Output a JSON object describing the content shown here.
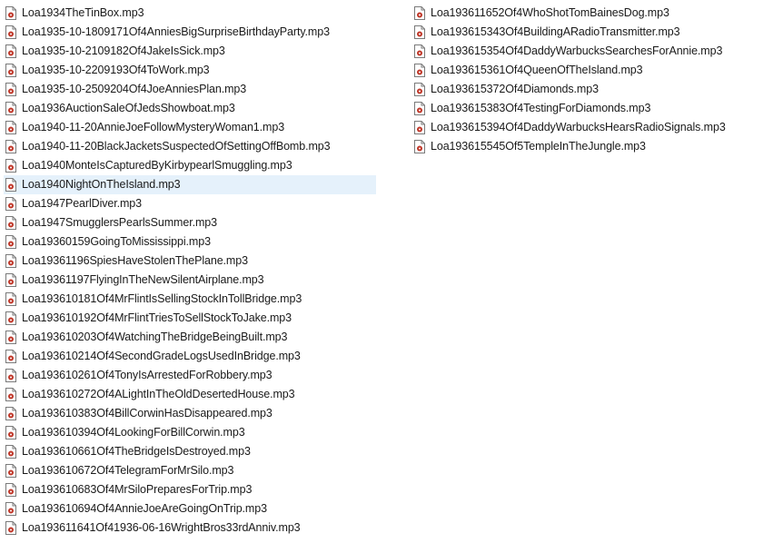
{
  "icon": "mp3-audio-file-icon",
  "colors": {
    "selection_background": "#e5f1fb",
    "icon_accent": "#c0392b"
  },
  "selected_file": "Loa1940NightOnTheIsland.mp3",
  "columns": [
    {
      "files": [
        "Loa1934TheTinBox.mp3",
        "Loa1935-10-1809171Of4AnniesBigSurpriseBirthdayParty.mp3",
        "Loa1935-10-2109182Of4JakeIsSick.mp3",
        "Loa1935-10-2209193Of4ToWork.mp3",
        "Loa1935-10-2509204Of4JoeAnniesPlan.mp3",
        "Loa1936AuctionSaleOfJedsShowboat.mp3",
        "Loa1940-11-20AnnieJoeFollowMysteryWoman1.mp3",
        "Loa1940-11-20BlackJacketsSuspectedOfSettingOffBomb.mp3",
        "Loa1940MonteIsCapturedByKirbypearlSmuggling.mp3",
        "Loa1940NightOnTheIsland.mp3",
        "Loa1947PearlDiver.mp3",
        "Loa1947SmugglersPearlsSummer.mp3",
        "Loa19360159GoingToMississippi.mp3",
        "Loa19361196SpiesHaveStolenThePlane.mp3",
        "Loa19361197FlyingInTheNewSilentAirplane.mp3",
        "Loa193610181Of4MrFlintIsSellingStockInTollBridge.mp3",
        "Loa193610192Of4MrFlintTriesToSellStockToJake.mp3",
        "Loa193610203Of4WatchingTheBridgeBeingBuilt.mp3",
        "Loa193610214Of4SecondGradeLogsUsedInBridge.mp3",
        "Loa193610261Of4TonyIsArrestedForRobbery.mp3",
        "Loa193610272Of4ALightInTheOldDesertedHouse.mp3",
        "Loa193610383Of4BillCorwinHasDisappeared.mp3",
        "Loa193610394Of4LookingForBillCorwin.mp3",
        "Loa193610661Of4TheBridgeIsDestroyed.mp3",
        "Loa193610672Of4TelegramForMrSilo.mp3",
        "Loa193610683Of4MrSiloPreparesForTrip.mp3",
        "Loa193610694Of4AnnieJoeAreGoingOnTrip.mp3",
        "Loa193611641Of41936-06-16WrightBros33rdAnniv.mp3"
      ]
    },
    {
      "files": [
        "Loa193611652Of4WhoShotTomBainesDog.mp3",
        "Loa193615343Of4BuildingARadioTransmitter.mp3",
        "Loa193615354Of4DaddyWarbucksSearchesForAnnie.mp3",
        "Loa193615361Of4QueenOfTheIsland.mp3",
        "Loa193615372Of4Diamonds.mp3",
        "Loa193615383Of4TestingForDiamonds.mp3",
        "Loa193615394Of4DaddyWarbucksHearsRadioSignals.mp3",
        "Loa193615545Of5TempleInTheJungle.mp3"
      ]
    }
  ]
}
